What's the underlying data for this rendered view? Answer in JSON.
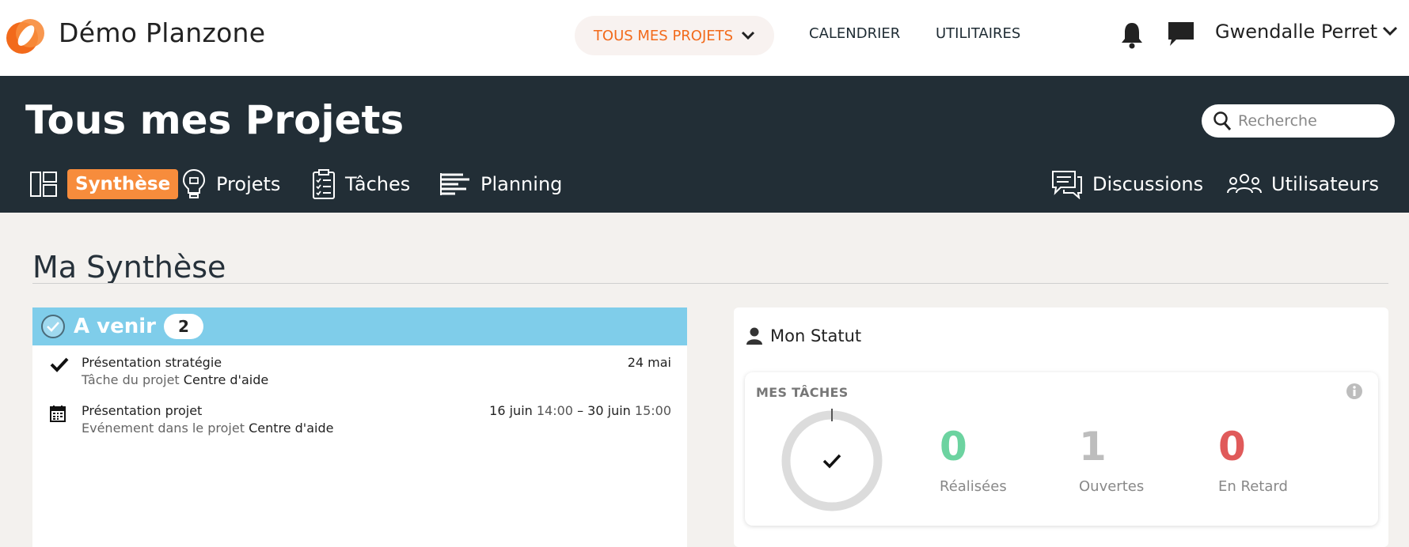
{
  "topbar": {
    "app_title": "Démo Planzone",
    "nav_projects": "TOUS MES PROJETS",
    "nav_calendar": "CALENDRIER",
    "nav_utilities": "UTILITAIRES",
    "user_name": "Gwendalle Perret",
    "accent_color": "#f26a1b"
  },
  "header": {
    "page_title": "Tous mes Projets",
    "search_placeholder": "Recherche",
    "tabs": [
      {
        "label": "Synthèse",
        "icon": "dashboard-icon",
        "active": true
      },
      {
        "label": "Projets",
        "icon": "lightbulb-icon"
      },
      {
        "label": "Tâches",
        "icon": "clipboard-icon"
      },
      {
        "label": "Planning",
        "icon": "gantt-icon"
      },
      {
        "label": "Discussions",
        "icon": "chat-bubbles-icon"
      },
      {
        "label": "Utilisateurs",
        "icon": "users-icon"
      }
    ]
  },
  "main": {
    "section_title": "Ma Synthèse",
    "upcoming": {
      "title": "A venir",
      "count": "2",
      "items": [
        {
          "title": "Présentation stratégie",
          "prefix": "Tâche du projet",
          "project": "Centre d'aide",
          "date": "24 mai",
          "icon": "check-icon"
        },
        {
          "title": "Présentation projet",
          "prefix": "Evénement dans le projet",
          "project": "Centre d'aide",
          "date_start": "16 juin",
          "time_start": "14:00",
          "sep": "–",
          "date_end": "30 juin",
          "time_end": "15:00",
          "icon": "calendar-icon"
        }
      ]
    },
    "status": {
      "title": "Mon Statut",
      "tasks_label": "MES TÂCHES",
      "stats": [
        {
          "value": "0",
          "label": "Réalisées",
          "color": "#6cd3a0"
        },
        {
          "value": "1",
          "label": "Ouvertes",
          "color": "#bdbdbd"
        },
        {
          "value": "0",
          "label": "En Retard",
          "color": "#e05a5a"
        }
      ]
    }
  }
}
